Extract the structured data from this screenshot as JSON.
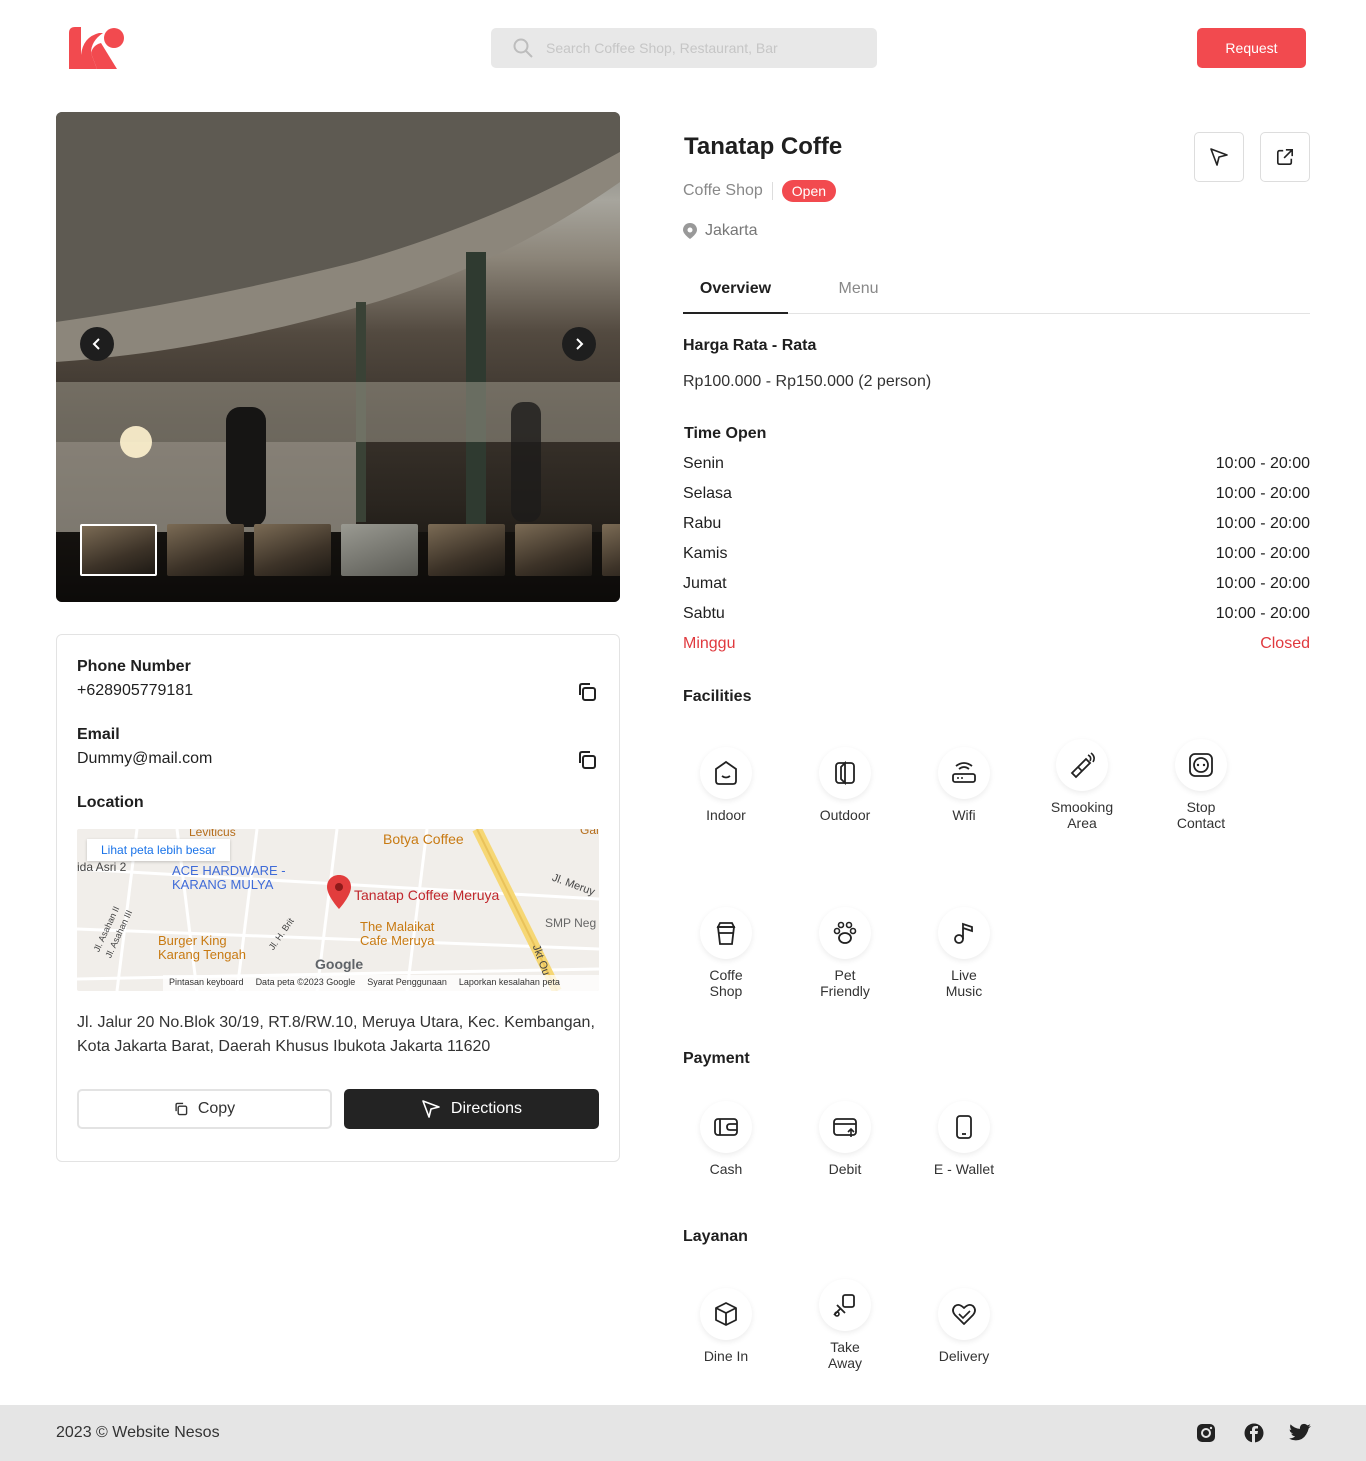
{
  "header": {
    "search_placeholder": "Search Coffee Shop, Restaurant, Bar",
    "request_label": "Request"
  },
  "contact": {
    "phone_label": "Phone Number",
    "phone": "+628905779181",
    "email_label": "Email",
    "email": "Dummy@mail.com",
    "location_label": "Location",
    "address_line1": "Jl. Jalur 20 No.Blok 30/19, RT.8/RW.10, Meruya Utara, Kec. Kembangan,",
    "address_line2": "Kota Jakarta Barat, Daerah Khusus Ibukota Jakarta 11620",
    "copy_label": "Copy",
    "directions_label": "Directions"
  },
  "map": {
    "larger_map": "Lihat peta lebih besar",
    "pin_label": "Tanatap Coffee Meruya",
    "places": [
      "Leviticus",
      "Botya Coffee",
      "ACE HARDWARE - KARANG MULYA",
      "The Malaikat Cafe Meruya",
      "Burger King Karang Tengah",
      "SMP Neg",
      "Jl. Meruy",
      "Jl. H. Brit",
      "Jl. Asahan II",
      "Jl. Asahan III",
      "ida Asri 2",
      "Jkt Ou",
      "Gar"
    ],
    "brand": "Google",
    "footer_links": [
      "Pintasan keyboard",
      "Data peta ©2023 Google",
      "Syarat Penggunaan",
      "Laporkan kesalahan peta"
    ]
  },
  "place": {
    "name": "Tanatap Coffe",
    "category": "Coffe Shop",
    "status": "Open",
    "city": "Jakarta"
  },
  "tabs": [
    "Overview",
    "Menu"
  ],
  "price": {
    "label": "Harga Rata - Rata",
    "value": "Rp100.000 - Rp150.000 (2 person)"
  },
  "hours": {
    "label": "Time Open",
    "days": [
      {
        "day": "Senin",
        "time": "10:00 - 20:00"
      },
      {
        "day": "Selasa",
        "time": "10:00 - 20:00"
      },
      {
        "day": "Rabu",
        "time": "10:00 - 20:00"
      },
      {
        "day": "Kamis",
        "time": "10:00 - 20:00"
      },
      {
        "day": "Jumat",
        "time": "10:00 - 20:00"
      },
      {
        "day": "Sabtu",
        "time": "10:00 - 20:00"
      },
      {
        "day": "Minggu",
        "time": "Closed"
      }
    ]
  },
  "facilities": {
    "label": "Facilities",
    "items": [
      {
        "line1": "Indoor",
        "line2": "",
        "icon": "indoor-icon"
      },
      {
        "line1": "Outdoor",
        "line2": "",
        "icon": "outdoor-icon"
      },
      {
        "line1": "Wifi",
        "line2": "",
        "icon": "wifi-router-icon"
      },
      {
        "line1": "Smooking",
        "line2": "Area",
        "icon": "smoking-icon"
      },
      {
        "line1": "Stop",
        "line2": "Contact",
        "icon": "socket-icon"
      },
      {
        "line1": "Coffe",
        "line2": "Shop",
        "icon": "coffee-cup-icon"
      },
      {
        "line1": "Pet",
        "line2": "Friendly",
        "icon": "paw-icon"
      },
      {
        "line1": "Live",
        "line2": "Music",
        "icon": "music-note-icon"
      }
    ]
  },
  "payment": {
    "label": "Payment",
    "items": [
      {
        "line1": "Cash",
        "icon": "wallet-icon"
      },
      {
        "line1": "Debit",
        "icon": "card-icon"
      },
      {
        "line1": "E - Wallet",
        "icon": "phone-icon"
      }
    ]
  },
  "services": {
    "label": "Layanan",
    "items": [
      {
        "line1": "Dine In",
        "line2": "",
        "icon": "box-icon"
      },
      {
        "line1": "Take",
        "line2": "Away",
        "icon": "cart-icon"
      },
      {
        "line1": "Delivery",
        "line2": "",
        "icon": "heart-hand-icon"
      }
    ]
  },
  "footer": {
    "copyright": "2023 © Website Nesos"
  },
  "colors": {
    "accent": "#f24a4f",
    "dark": "#232323"
  }
}
